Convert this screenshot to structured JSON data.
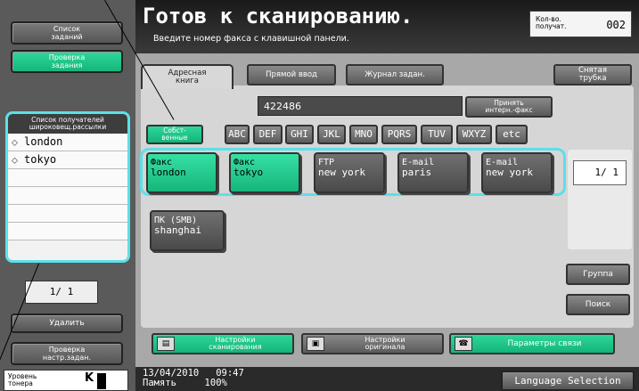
{
  "left": {
    "job_list": "Список\nзаданий",
    "job_check": "Проверка\nзадания",
    "recipients_header": "Список получателей\nшироковещ.рассылки",
    "recipients": [
      {
        "icon": "fax-icon",
        "name": "london"
      },
      {
        "icon": "fax-icon",
        "name": "tokyo"
      }
    ],
    "page": "1/  1",
    "delete": "Удалить",
    "check_settings": "Проверка\nнастр.задан.",
    "toner_label": "Уровень\nтонера",
    "toner_color": "K"
  },
  "header": {
    "title": "Готов к сканированию.",
    "subtitle": "Введите номер факса с клавишной панели.",
    "counter_label": "Кол-во.\nполучат.",
    "counter_value": "002"
  },
  "tabs": {
    "address_book": "Адресная\nкнига",
    "direct_input": "Прямой ввод",
    "job_history": "Журнал задан.",
    "offhook": "Снятая\nтрубка"
  },
  "input": {
    "value": "422486",
    "accept_button": "Принять\nинтерн.-факс"
  },
  "index": [
    "Собст-\nвенные",
    "ABC",
    "DEF",
    "GHI",
    "JKL",
    "MNO",
    "PQRS",
    "TUV",
    "WXYZ",
    "etc"
  ],
  "destinations": [
    {
      "type": "Факс",
      "name": "london",
      "selected": true
    },
    {
      "type": "Факс",
      "name": "tokyo",
      "selected": true
    },
    {
      "type": "FTP",
      "name": "new york",
      "selected": false
    },
    {
      "type": "E-mail",
      "name": "paris",
      "selected": false
    },
    {
      "type": "E-mail",
      "name": "new york",
      "selected": false
    },
    {
      "type": "ПК (SMB)",
      "name": "shanghai",
      "selected": false
    }
  ],
  "page_indicator": "1/  1",
  "group_button": "Группа",
  "search_button": "Поиск",
  "bottom_buttons": {
    "scan_settings": "Настройки\nсканирования",
    "original_settings": "Настройки\nоригинала",
    "comm_settings": "Параметры связи"
  },
  "footer": {
    "date": "13/04/2010",
    "time": "09:47",
    "memory_label": "Память",
    "memory_value": "100%",
    "language": "Language Selection"
  },
  "colors": {
    "green": "#1dc489",
    "highlight": "#5ce0e8"
  }
}
